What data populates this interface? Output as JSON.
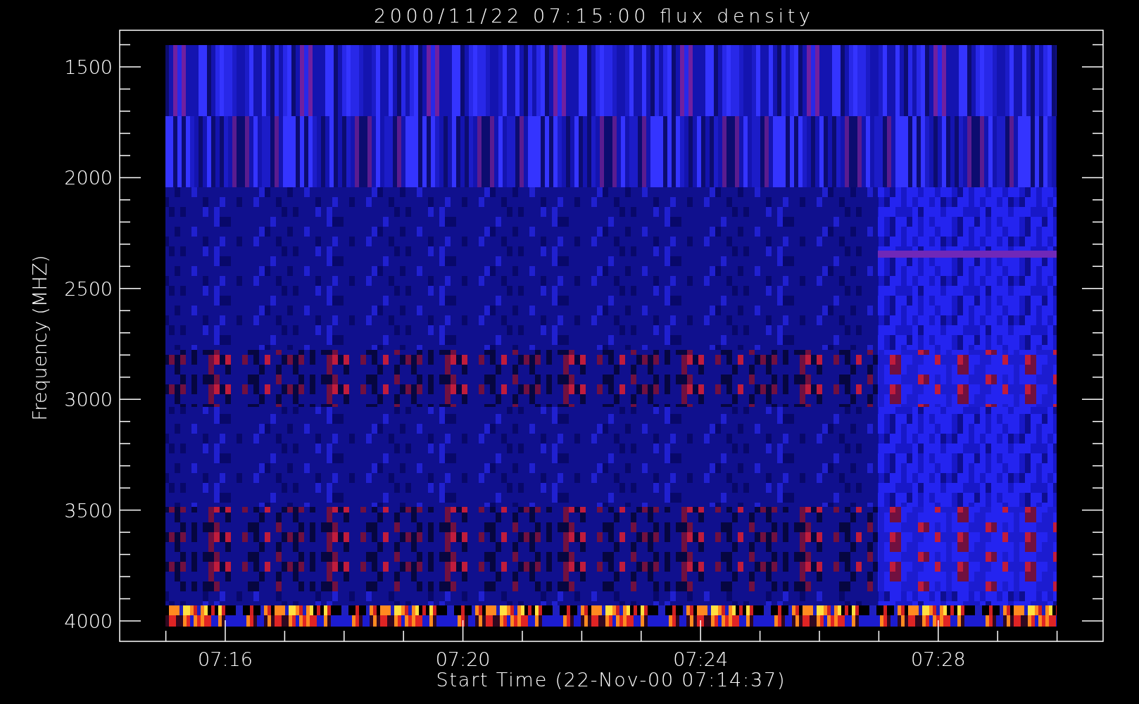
{
  "title": "2000/11/22 07:15:00 flux density",
  "y_axis": {
    "label": "Frequency (MHZ)",
    "ticks": [
      "1500",
      "2000",
      "2500",
      "3000",
      "3500",
      "4000"
    ]
  },
  "x_axis": {
    "label": "Start Time (22-Nov-00 07:14:37)",
    "ticks": [
      "07:16",
      "07:20",
      "07:24",
      "07:28"
    ]
  }
}
